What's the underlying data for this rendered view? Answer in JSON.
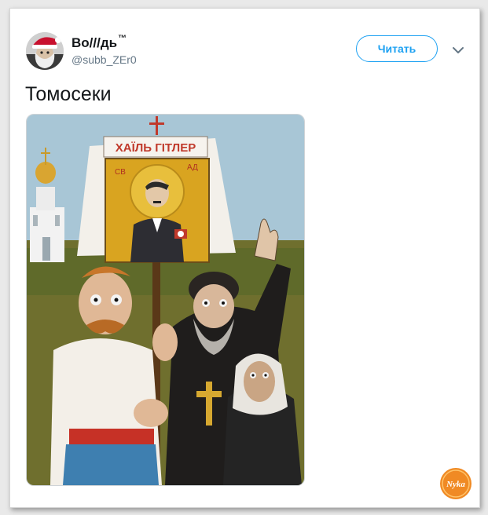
{
  "tweet": {
    "display_name": "Во///дь",
    "trademark": "™",
    "handle": "@subb_ZEr0",
    "follow_label": "Читать",
    "text": "Томосеки"
  },
  "media": {
    "banner_text": "ХАЇЛЬ ГІТЛЕР",
    "icon_left_text": "СВ",
    "icon_right_text": "АД"
  },
  "watermark": {
    "text": "Nyka"
  },
  "colors": {
    "accent": "#1da1f2",
    "text": "#14171a",
    "muted": "#657786"
  }
}
